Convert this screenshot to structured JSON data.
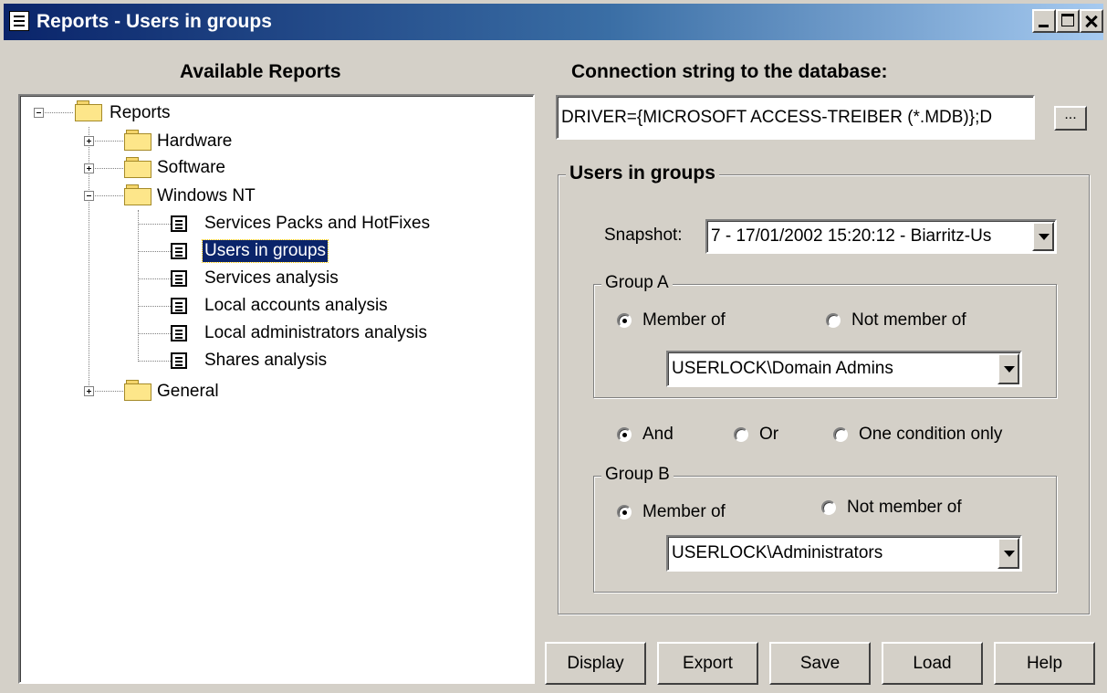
{
  "window": {
    "title": "Reports - Users in groups"
  },
  "left": {
    "heading": "Available Reports",
    "tree": {
      "root": "Reports",
      "hardware": "Hardware",
      "software": "Software",
      "windows_nt": "Windows NT",
      "reports": [
        "Services Packs and HotFixes",
        "Users in groups",
        "Services analysis",
        "Local accounts analysis",
        "Local administrators analysis",
        "Shares analysis"
      ],
      "general": "General",
      "selected": "Users in groups"
    }
  },
  "right": {
    "conn_heading": "Connection string to the database:",
    "conn_value": "DRIVER={MICROSOFT ACCESS-TREIBER (*.MDB)};D",
    "browse_label": "...",
    "group_title": "Users in groups",
    "snapshot_label": "Snapshot:",
    "snapshot_value": "7 - 17/01/2002 15:20:12 - Biarritz-Us",
    "group_a": {
      "title": "Group A",
      "member_of": "Member of",
      "not_member_of": "Not member of",
      "selected": "member_of",
      "value": "USERLOCK\\Domain Admins"
    },
    "logic": {
      "and": "And",
      "or": "Or",
      "one": "One condition only",
      "selected": "and"
    },
    "group_b": {
      "title": "Group B",
      "member_of": "Member of",
      "not_member_of": "Not member of",
      "selected": "member_of",
      "value": "USERLOCK\\Administrators"
    }
  },
  "buttons": {
    "display": "Display",
    "export": "Export",
    "save": "Save",
    "load": "Load",
    "help": "Help"
  }
}
